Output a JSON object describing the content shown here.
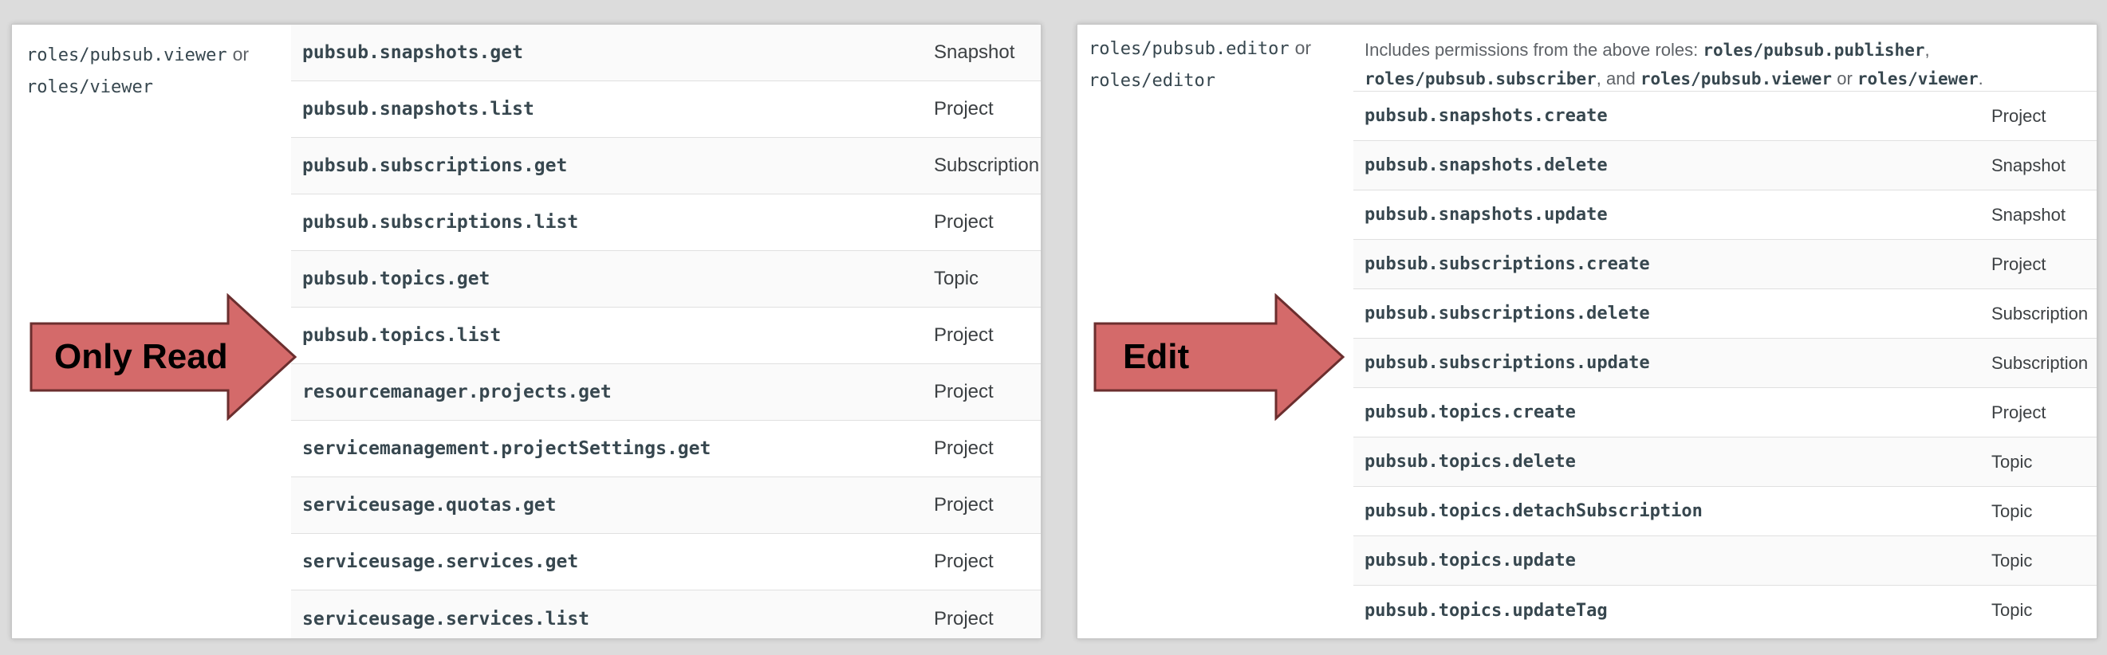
{
  "colors": {
    "arrow_fill": "#d46a6a",
    "arrow_stroke": "#6b2e2e",
    "background": "#dcdcdc",
    "panel": "#ffffff"
  },
  "left_panel": {
    "role": {
      "name": "roles/pubsub.viewer",
      "or": "or",
      "alt": "roles/viewer"
    },
    "rows": [
      {
        "permission": "pubsub.snapshots.get",
        "resource": "Snapshot"
      },
      {
        "permission": "pubsub.snapshots.list",
        "resource": "Project"
      },
      {
        "permission": "pubsub.subscriptions.get",
        "resource": "Subscription"
      },
      {
        "permission": "pubsub.subscriptions.list",
        "resource": "Project"
      },
      {
        "permission": "pubsub.topics.get",
        "resource": "Topic"
      },
      {
        "permission": "pubsub.topics.list",
        "resource": "Project"
      },
      {
        "permission": "resourcemanager.projects.get",
        "resource": "Project"
      },
      {
        "permission": "servicemanagement.projectSettings.get",
        "resource": "Project"
      },
      {
        "permission": "serviceusage.quotas.get",
        "resource": "Project"
      },
      {
        "permission": "serviceusage.services.get",
        "resource": "Project"
      },
      {
        "permission": "serviceusage.services.list",
        "resource": "Project"
      }
    ],
    "arrow_label": "Only Read"
  },
  "right_panel": {
    "role": {
      "name": "roles/pubsub.editor",
      "or": "or",
      "alt": "roles/editor"
    },
    "description": {
      "prefix": "Includes permissions from the above roles:",
      "role1": "roles/pubsub.publisher",
      "sep1": ",",
      "role2": "roles/pubsub.subscriber",
      "sep2": ", and",
      "role3": "roles/pubsub.viewer",
      "or": "or",
      "role4": "roles/viewer",
      "end": "."
    },
    "rows": [
      {
        "permission": "pubsub.snapshots.create",
        "resource": "Project"
      },
      {
        "permission": "pubsub.snapshots.delete",
        "resource": "Snapshot"
      },
      {
        "permission": "pubsub.snapshots.update",
        "resource": "Snapshot"
      },
      {
        "permission": "pubsub.subscriptions.create",
        "resource": "Project"
      },
      {
        "permission": "pubsub.subscriptions.delete",
        "resource": "Subscription"
      },
      {
        "permission": "pubsub.subscriptions.update",
        "resource": "Subscription"
      },
      {
        "permission": "pubsub.topics.create",
        "resource": "Project"
      },
      {
        "permission": "pubsub.topics.delete",
        "resource": "Topic"
      },
      {
        "permission": "pubsub.topics.detachSubscription",
        "resource": "Topic"
      },
      {
        "permission": "pubsub.topics.update",
        "resource": "Topic"
      },
      {
        "permission": "pubsub.topics.updateTag",
        "resource": "Topic"
      }
    ],
    "arrow_label": "Edit"
  }
}
